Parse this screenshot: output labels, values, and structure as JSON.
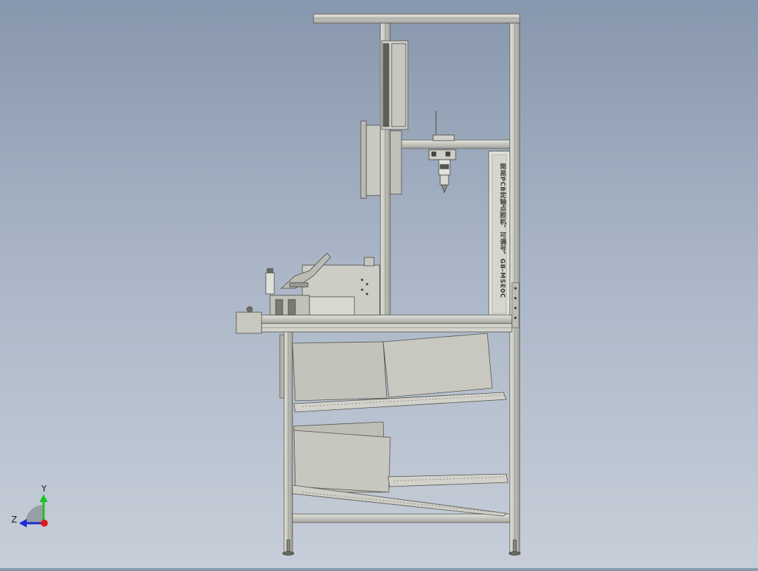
{
  "machine": {
    "side_label": "简易PCB定轴点胶机，可调号，GB-MSE0C"
  },
  "triad": {
    "y_label": "Y",
    "z_label": "Z",
    "colors": {
      "y": "#1fbf2a",
      "z": "#1a2bd6",
      "x": "#e01818"
    }
  },
  "colors": {
    "frame": "#c9c9c2",
    "frame_dark": "#6d6d68",
    "panel": "#c3c3bb",
    "background_top": "#8797ad",
    "background_bottom": "#c7ced9"
  }
}
